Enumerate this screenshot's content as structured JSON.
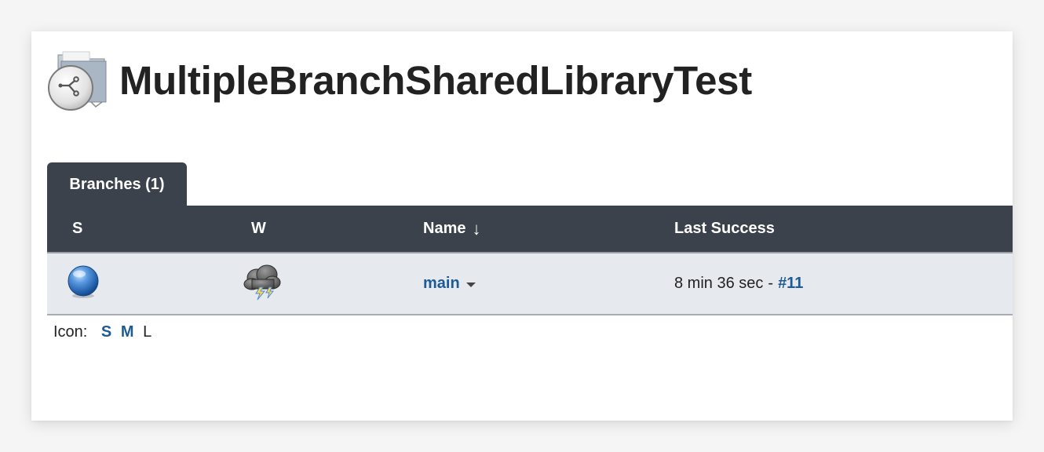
{
  "page": {
    "title": "MultipleBranchSharedLibraryTest"
  },
  "tabs": [
    {
      "label": "Branches (1)"
    }
  ],
  "table": {
    "columns": {
      "status": "S",
      "weather": "W",
      "name": "Name",
      "name_sort_indicator": "↓",
      "last_success": "Last Success"
    },
    "rows": [
      {
        "status_icon": "blue-ball-icon",
        "weather_icon": "thunderstorm-icon",
        "name": "main",
        "last_success_time": "8 min 36 sec",
        "last_success_separator": "-",
        "last_success_build": "#11"
      }
    ]
  },
  "icon_size": {
    "label": "Icon:",
    "options": [
      "S",
      "M",
      "L"
    ]
  },
  "colors": {
    "header_bg": "#3b424b",
    "row_bg": "#e6eaef",
    "link": "#1d5b97"
  }
}
